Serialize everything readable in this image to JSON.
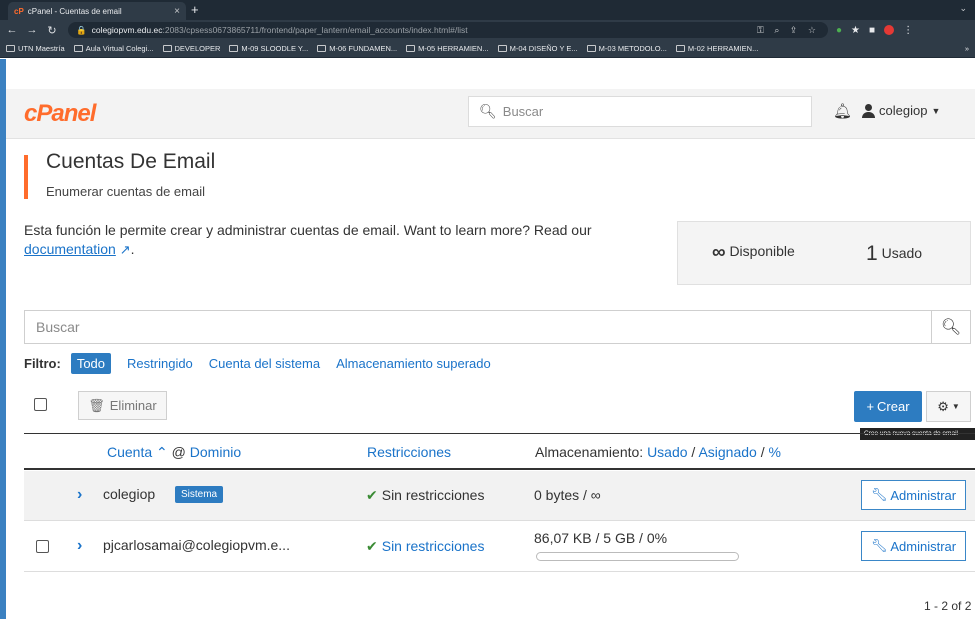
{
  "browser": {
    "tab_title": "cPanel - Cuentas de email",
    "tab_close": "×",
    "new_tab": "+",
    "url_host": "colegiopvm.edu.ec",
    "url_path": ":2083/cpsess0673865711/frontend/paper_lantern/email_accounts/index.html#/list",
    "bookmarks": [
      "UTN Maestría",
      "Aula Virtual Colegi...",
      "DEVELOPER",
      "M-09 SLOODLE Y...",
      "M-06 FUNDAMEN...",
      "M-05 HERRAMIEN...",
      "M-04 DISEÑO Y E...",
      "M-03 METODOLO...",
      "M-02 HERRAMIEN..."
    ],
    "bookmarks_more": "»"
  },
  "header": {
    "logo": "cPanel",
    "search_placeholder": "Buscar",
    "username": "colegiop"
  },
  "page": {
    "title": "Cuentas De Email",
    "subtitle": "Enumerar cuentas de email",
    "description": "Esta función le permite crear y administrar cuentas de email. Want to learn more? Read our",
    "doc_link": "documentation",
    "doc_suffix": "."
  },
  "usage": {
    "available_symbol": "∞",
    "available_label": "Disponible",
    "used_count": "1",
    "used_label": "Usado"
  },
  "search": {
    "placeholder": "Buscar"
  },
  "filter": {
    "label": "Filtro:",
    "options": [
      "Todo",
      "Restringido",
      "Cuenta del sistema",
      "Almacenamiento superado"
    ],
    "active": "Todo"
  },
  "toolbar": {
    "delete_label": "Eliminar",
    "create_label": "Crear",
    "create_tooltip": "Cree una nueva cuenta de email"
  },
  "table": {
    "col_account": "Cuenta",
    "col_at": "@",
    "col_domain": "Dominio",
    "col_restrictions": "Restricciones",
    "col_storage_prefix": "Almacenamiento:",
    "col_used": "Usado",
    "col_sep": "/",
    "col_assigned": "Asignado",
    "col_percent": "%",
    "rows": [
      {
        "account": "colegiop",
        "badge": "Sistema",
        "restrictions": "Sin restricciones",
        "storage": "0 bytes / ∞",
        "manage": "Administrar"
      },
      {
        "account": "pjcarlosamai@colegiopvm.e...",
        "restrictions": "Sin restricciones",
        "storage": "86,07 KB / 5 GB / 0%",
        "usage_fraction": 0,
        "manage": "Administrar"
      }
    ]
  },
  "pagination": "1 - 2 of 2",
  "colors": {
    "brand": "#ff6c2c",
    "primary": "#2d7cc1",
    "link": "#1a73c9",
    "success": "#3a8b34"
  }
}
